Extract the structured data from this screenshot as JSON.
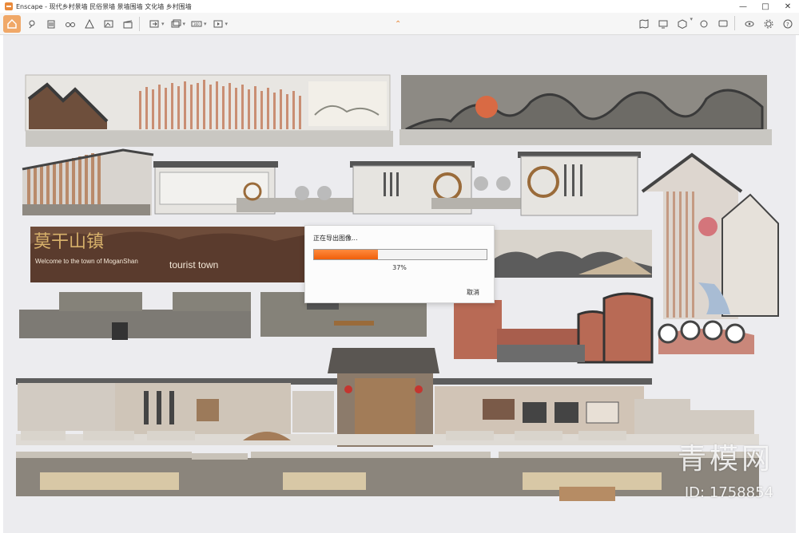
{
  "window": {
    "app_name": "Enscape",
    "title": "Enscape - 现代乡村景墙 民俗景墙 景墙围墙 文化墙 乡村围墙",
    "controls": [
      "—",
      "□",
      "✕"
    ]
  },
  "toolbar": {
    "left_icons": [
      "home-icon",
      "pin-icon",
      "bin-icon",
      "binoculars-icon",
      "view-icon",
      "landscape-icon",
      "clapper-icon",
      "export-image-icon",
      "batch-render-icon",
      "panorama-icon",
      "export-video-icon"
    ],
    "right_icons": [
      "map-icon",
      "screen-icon",
      "cube-icon",
      "sync-icon",
      "chat-icon",
      "eye-icon",
      "settings-icon",
      "help-icon"
    ]
  },
  "dialog": {
    "title": "正在导出图像...",
    "progress_percent": 37,
    "progress_label": "37%",
    "cancel_label": "取消"
  },
  "scene": {
    "sign_text_1": "Welcome to the town of MoganShan",
    "sign_text_2": "tourist town",
    "calligraphy": "莫干山镇"
  },
  "watermark": {
    "brand": "青模网",
    "id": "ID: 1758854"
  },
  "colors": {
    "accent": "#e9893a",
    "progress": "#f26d12",
    "viewport_bg": "#ececef"
  }
}
